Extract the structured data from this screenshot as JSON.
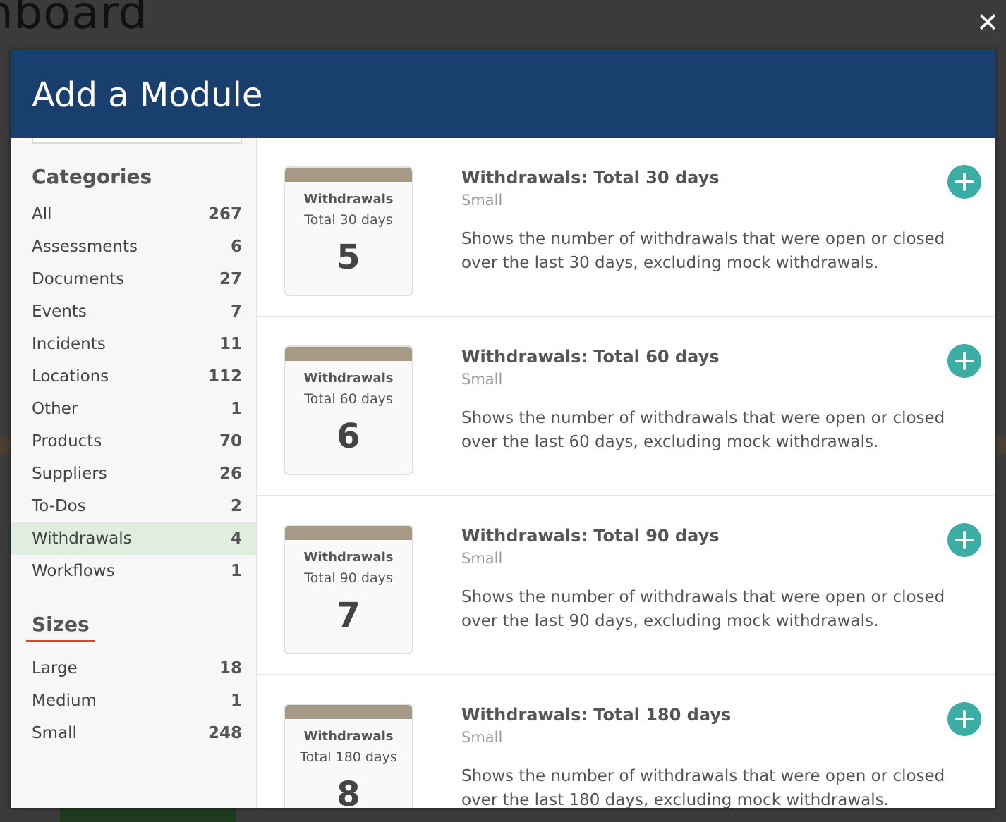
{
  "background": {
    "page_heading": "hboard"
  },
  "modal": {
    "title": "Add a Module",
    "close_label": "✕"
  },
  "sidebar": {
    "categories_title": "Categories",
    "categories": [
      {
        "label": "All",
        "count": "267"
      },
      {
        "label": "Assessments",
        "count": "6"
      },
      {
        "label": "Documents",
        "count": "27"
      },
      {
        "label": "Events",
        "count": "7"
      },
      {
        "label": "Incidents",
        "count": "11"
      },
      {
        "label": "Locations",
        "count": "112"
      },
      {
        "label": "Other",
        "count": "1"
      },
      {
        "label": "Products",
        "count": "70"
      },
      {
        "label": "Suppliers",
        "count": "26"
      },
      {
        "label": "To-Dos",
        "count": "2"
      },
      {
        "label": "Withdrawals",
        "count": "4",
        "active": true
      },
      {
        "label": "Workflows",
        "count": "1"
      }
    ],
    "sizes_title": "Sizes",
    "sizes": [
      {
        "label": "Large",
        "count": "18"
      },
      {
        "label": "Medium",
        "count": "1"
      },
      {
        "label": "Small",
        "count": "248"
      }
    ]
  },
  "modules": [
    {
      "card_name": "Withdrawals",
      "card_sub": "Total 30 days",
      "card_value": "5",
      "title": "Withdrawals: Total 30 days",
      "size": "Small",
      "description": "Shows the number of withdrawals that were open or closed over the last 30 days, excluding mock withdrawals."
    },
    {
      "card_name": "Withdrawals",
      "card_sub": "Total 60 days",
      "card_value": "6",
      "title": "Withdrawals: Total 60 days",
      "size": "Small",
      "description": "Shows the number of withdrawals that were open or closed over the last 60 days, excluding mock withdrawals."
    },
    {
      "card_name": "Withdrawals",
      "card_sub": "Total 90 days",
      "card_value": "7",
      "title": "Withdrawals: Total 90 days",
      "size": "Small",
      "description": "Shows the number of withdrawals that were open or closed over the last 90 days, excluding mock withdrawals."
    },
    {
      "card_name": "Withdrawals",
      "card_sub": "Total 180 days",
      "card_value": "8",
      "title": "Withdrawals: Total 180 days",
      "size": "Small",
      "description": "Shows the number of withdrawals that were open or closed over the last 180 days, excluding mock withdrawals."
    }
  ],
  "colors": {
    "header_bg": "#193f6e",
    "add_button": "#3aada5",
    "active_category_bg": "#dfeedf",
    "card_bar": "#a69a86",
    "sizes_underline": "#d9472b"
  },
  "icons": {
    "close": "close-icon",
    "add": "plus-circle-icon"
  }
}
